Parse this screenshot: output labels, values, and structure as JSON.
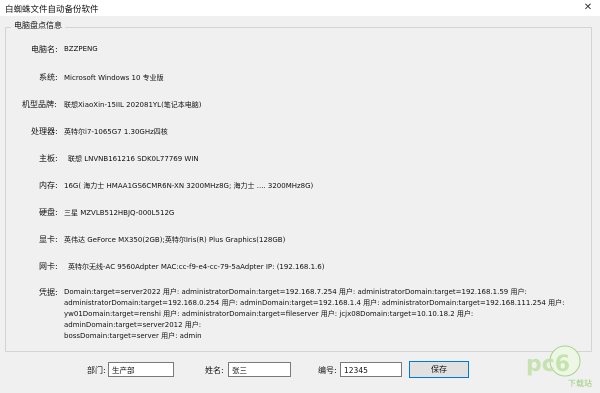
{
  "window": {
    "title": "白蜘蛛文件自动备份软件",
    "close_glyph": "✕"
  },
  "group_title": "电脑盘点信息",
  "info": [
    {
      "label": "电脑名:",
      "value": "BZZPENG"
    },
    {
      "label": "系统:",
      "value": "Microsoft Windows 10 专业版"
    },
    {
      "label": "机型品牌:",
      "value": "联想XiaoXin-15IIL 202081YL(笔记本电脑)"
    },
    {
      "label": "处理器:",
      "value": "英特尔i7-1065G7 1.30GHz四核"
    },
    {
      "label": "主板:",
      "value": "联想 LNVNB161216 SDK0L77769 WIN"
    },
    {
      "label": "内存:",
      "value": "16G( 海力士 HMAA1GS6CMR6N-XN 3200MHz8G; 海力士 .... 3200MHz8G)"
    },
    {
      "label": "硬盘:",
      "value": "三星 MZVLB512HBJQ-000L512G"
    },
    {
      "label": "显卡:",
      "value": "英伟达 GeForce MX350(2GB);英特尔Iris(R) Plus Graphics(128GB)"
    },
    {
      "label": "网卡:",
      "value": "英特尔无线-AC 9560Adpter MAC:cc-f9-e4-cc-79-5aAdpter IP: (192.168.1.6)"
    }
  ],
  "credentials": {
    "label": "凭据:",
    "lines": [
      "Domain:target=server2022 用户: administratorDomain:target=192.168.7.254 用户: administratorDomain:target=192.168.1.59 用户:",
      "administratorDomain:target=192.168.0.254 用户: adminDomain:target=192.168.1.4 用户: administratorDomain:target=192.168.111.254 用户:",
      "yw01Domain:target=renshi 用户: administratorDomain:target=fileserver 用户: jcjx08Domain:target=10.10.18.2 用户: adminDomain:target=server2012 用户:",
      "bossDomain:target=server 用户: admin"
    ]
  },
  "form": {
    "dept_label": "部门:",
    "dept_value": "生产部",
    "name_label": "姓名:",
    "name_value": "张三",
    "id_label": "编号:",
    "id_value": "12345",
    "save_label": "保存"
  },
  "watermark": {
    "logo_text": "pc6",
    "sub_text": "下载站"
  }
}
